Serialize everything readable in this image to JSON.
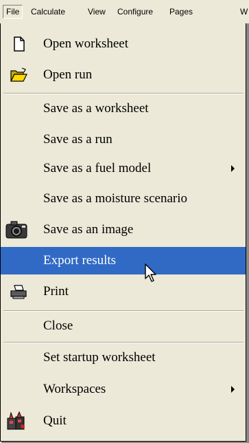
{
  "menubar": {
    "items": [
      "File",
      "Calculate",
      "View",
      "Configure",
      "Pages",
      "W"
    ]
  },
  "menu": {
    "items": [
      {
        "label": "Open worksheet",
        "icon": "document-icon"
      },
      {
        "label": "Open run",
        "icon": "open-folder-icon"
      },
      {
        "label": "Save as a worksheet"
      },
      {
        "label": "Save as a run"
      },
      {
        "label": "Save as a fuel model",
        "submenu": true
      },
      {
        "label": "Save as a moisture scenario"
      },
      {
        "label": "Save as an image",
        "icon": "camera-icon"
      },
      {
        "label": "Export results",
        "highlighted": true
      },
      {
        "label": "Print",
        "icon": "printer-icon"
      },
      {
        "label": "Close"
      },
      {
        "label": "Set startup worksheet"
      },
      {
        "label": "Workspaces",
        "submenu": true
      },
      {
        "label": "Quit",
        "icon": "quit-icon"
      }
    ]
  },
  "colors": {
    "menu_bg": "#ece9d8",
    "highlight": "#316ac5"
  }
}
